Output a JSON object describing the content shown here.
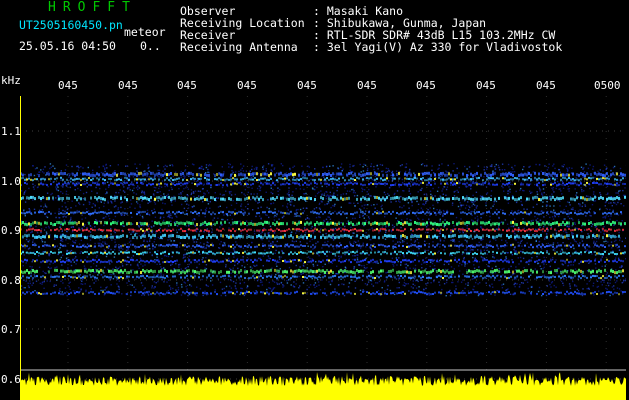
{
  "header": {
    "logo": "HROFFT",
    "filename": "UT2505160450.pn",
    "mode": "meteor",
    "datetime": "25.05.16 04:50",
    "count": "0..",
    "fields": [
      {
        "label": "Observer",
        "value": ": Masaki Kano"
      },
      {
        "label": "Receiving Location",
        "value": ": Shibukawa, Gunma, Japan"
      },
      {
        "label": "Receiver",
        "value": ": RTL-SDR SDR# 43dB L15 103.2MHz CW"
      },
      {
        "label": "Receiving Antenna",
        "value": ": 3el Yagi(V) Az 330 for Vladivostok"
      }
    ]
  },
  "axes": {
    "y_unit": "kHz",
    "y_ticks": [
      "1.1",
      "1.0",
      "0.9",
      "0.8",
      "0.7",
      "0.6"
    ],
    "x_ticks": [
      "045",
      "045",
      "045",
      "045",
      "045",
      "045",
      "045",
      "045",
      "045",
      "0500"
    ]
  },
  "colors": {
    "text_green": "#00c800",
    "text_cyan": "#00e6ff",
    "axis_yellow": "#ffff00",
    "spectrum_yellow": "#ffff00"
  }
}
